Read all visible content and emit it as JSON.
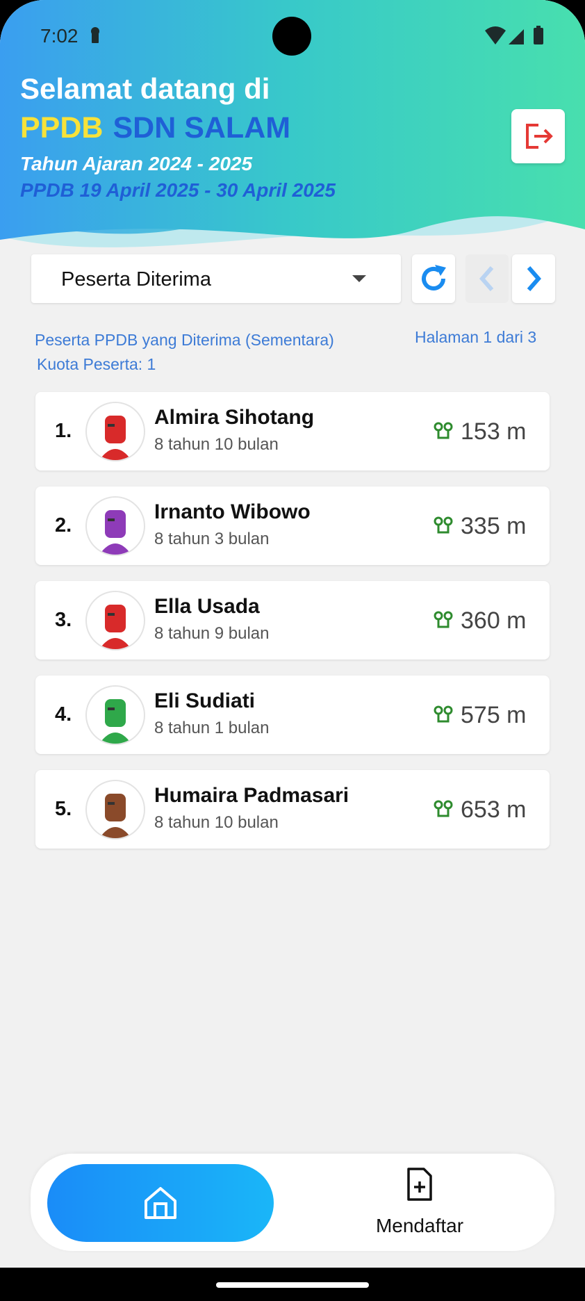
{
  "status_bar": {
    "time": "7:02"
  },
  "header": {
    "welcome": "Selamat datang di",
    "brand_ppdb": "PPDB",
    "brand_school": "SDN SALAM",
    "academic_year": "Tahun Ajaran 2024 - 2025",
    "period": "PPDB 19 April 2025 - 30 April 2025"
  },
  "controls": {
    "filter_selected": "Peserta Diterima",
    "info_title": "Peserta PPDB yang Diterima (Sementara)",
    "quota": "Kuota Peserta: 1",
    "pagination": "Halaman 1 dari 3"
  },
  "participants": [
    {
      "rank": "1.",
      "name": "Almira Sihotang",
      "age": "8 tahun 10 bulan",
      "distance": "153 m",
      "avatar_color": "#d82a2a"
    },
    {
      "rank": "2.",
      "name": "Irnanto Wibowo",
      "age": "8 tahun 3 bulan",
      "distance": "335 m",
      "avatar_color": "#8e3bb8"
    },
    {
      "rank": "3.",
      "name": "Ella Usada",
      "age": "8 tahun 9 bulan",
      "distance": "360 m",
      "avatar_color": "#d82a2a"
    },
    {
      "rank": "4.",
      "name": "Eli Sudiati",
      "age": "8 tahun 1 bulan",
      "distance": "575 m",
      "avatar_color": "#2fa84a"
    },
    {
      "rank": "5.",
      "name": "Humaira Padmasari",
      "age": "8 tahun 10 bulan",
      "distance": "653 m",
      "avatar_color": "#8a4a2a"
    }
  ],
  "bottom_nav": {
    "register_label": "Mendaftar"
  },
  "colors": {
    "accent_blue": "#1f5fd6",
    "brand_yellow": "#f7e23a",
    "teal": "#3fd8b0",
    "logout_red": "#e53935",
    "distance_green": "#2e8b2e"
  }
}
